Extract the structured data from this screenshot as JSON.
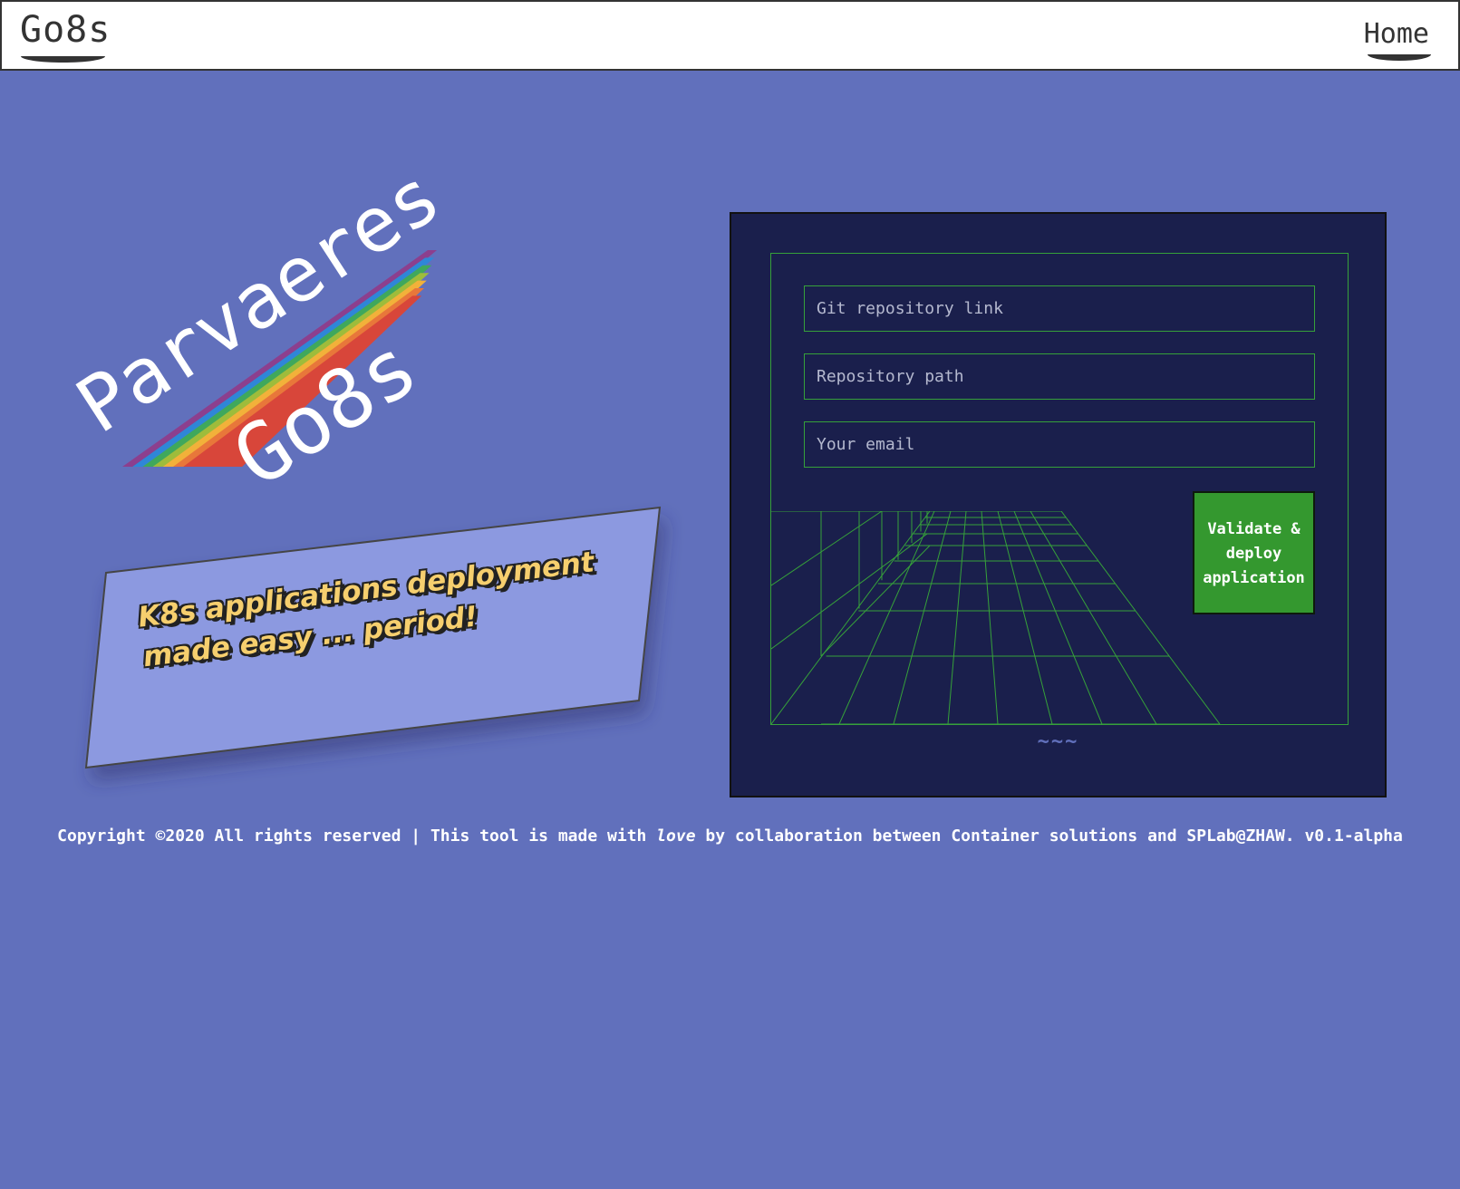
{
  "navbar": {
    "brand": "Go8s",
    "home_link": "Home"
  },
  "logo": {
    "line1": "Parvaeres",
    "line2": "Go8s",
    "stripe_colors": [
      "#8c3f8e",
      "#2f86d8",
      "#3fa85c",
      "#9ebc3b",
      "#f2b13a",
      "#e8773a",
      "#d8463a"
    ]
  },
  "tagline": {
    "text": "K8s applications deployment made easy ... period!"
  },
  "form": {
    "git_placeholder": "Git repository link",
    "path_placeholder": "Repository path",
    "email_placeholder": "Your email",
    "submit_label": "Validate & deploy application",
    "decoration": "~~~"
  },
  "footer": {
    "before_love": "Copyright ©2020 All rights reserved | This tool is made with ",
    "love": "love",
    "after_love": " by collaboration between Container solutions and SPLab@ZHAW. v0.1-alpha"
  },
  "colors": {
    "background": "#6170bc",
    "panel": "#1a1f4c",
    "accent_green": "#36a13a",
    "button_green": "#34982f",
    "tagline_yellow": "#f6cf6e",
    "card": "#8c99e0"
  }
}
